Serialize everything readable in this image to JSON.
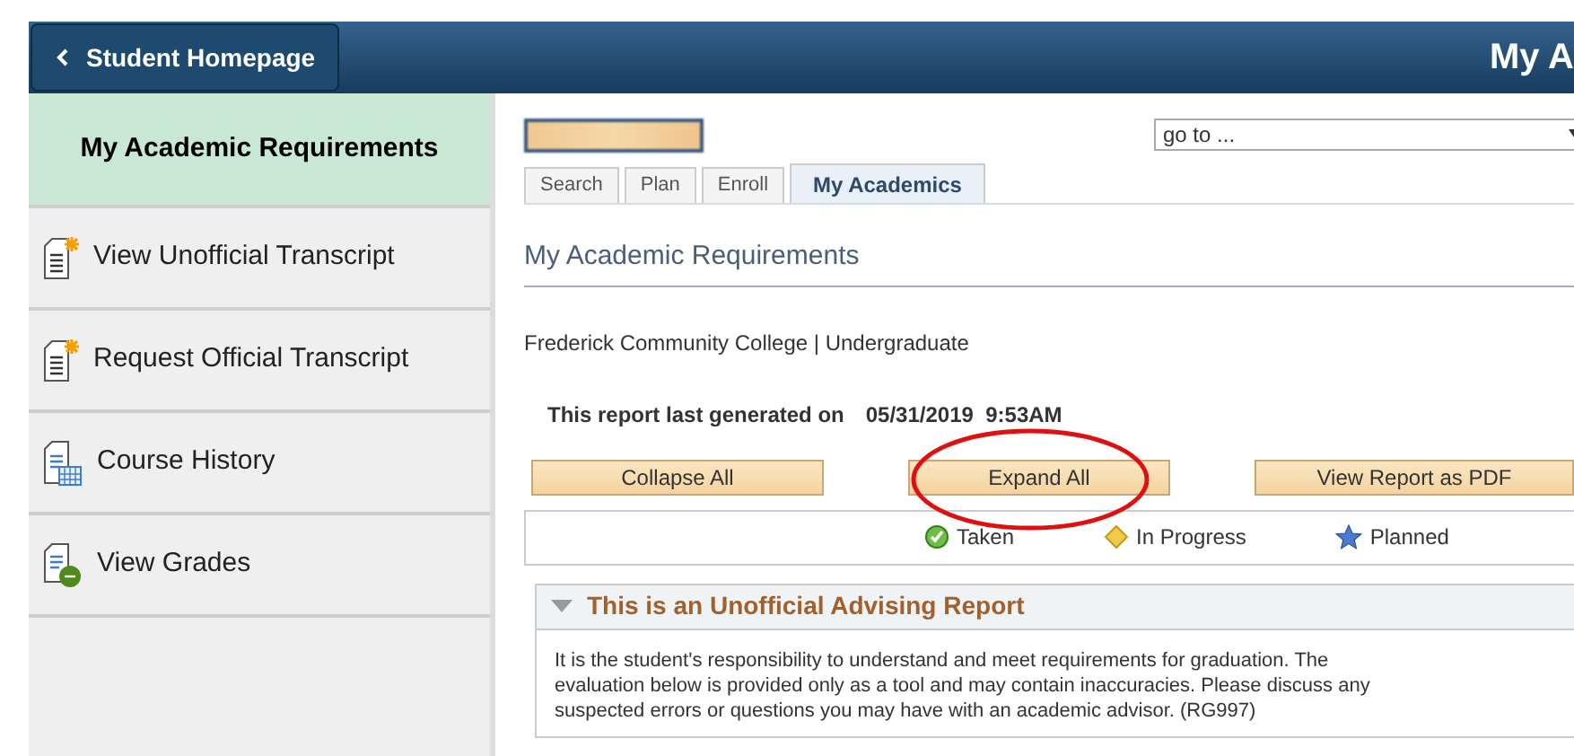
{
  "header": {
    "back_button": "Student Homepage",
    "title": "My A"
  },
  "sidebar": {
    "items": [
      {
        "label": "My Academic Requirements",
        "kind": "heading",
        "selected": true
      },
      {
        "label": "View Unofficial Transcript",
        "kind": "transcript",
        "selected": false
      },
      {
        "label": "Request Official Transcript",
        "kind": "transcript",
        "selected": false
      },
      {
        "label": "Course History",
        "kind": "history",
        "selected": false
      },
      {
        "label": "View Grades",
        "kind": "grades",
        "selected": false
      }
    ]
  },
  "goto": {
    "value": "go to ..."
  },
  "tabs": [
    {
      "label": "Search",
      "selected": false
    },
    {
      "label": "Plan",
      "selected": false
    },
    {
      "label": "Enroll",
      "selected": false
    },
    {
      "label": "My Academics",
      "selected": true
    }
  ],
  "page_title": "My Academic Requirements",
  "institution": "Frederick Community College | Undergraduate",
  "report": {
    "label": "This report last generated on",
    "date": "05/31/2019  9:53AM"
  },
  "buttons": [
    "Collapse All",
    "Expand All",
    "View Report as PDF"
  ],
  "legend": [
    {
      "kind": "taken",
      "label": "Taken"
    },
    {
      "kind": "progress",
      "label": "In Progress"
    },
    {
      "kind": "planned",
      "label": "Planned"
    }
  ],
  "section": {
    "title": "This is an Unofficial Advising Report",
    "expanded": true,
    "text": "It is the student's responsibility to understand and meet requirements for graduation. The evaluation below is provided only as a tool and may contain inaccuracies. Please discuss any suspected errors or questions you may have with an academic advisor. (RG997)"
  }
}
